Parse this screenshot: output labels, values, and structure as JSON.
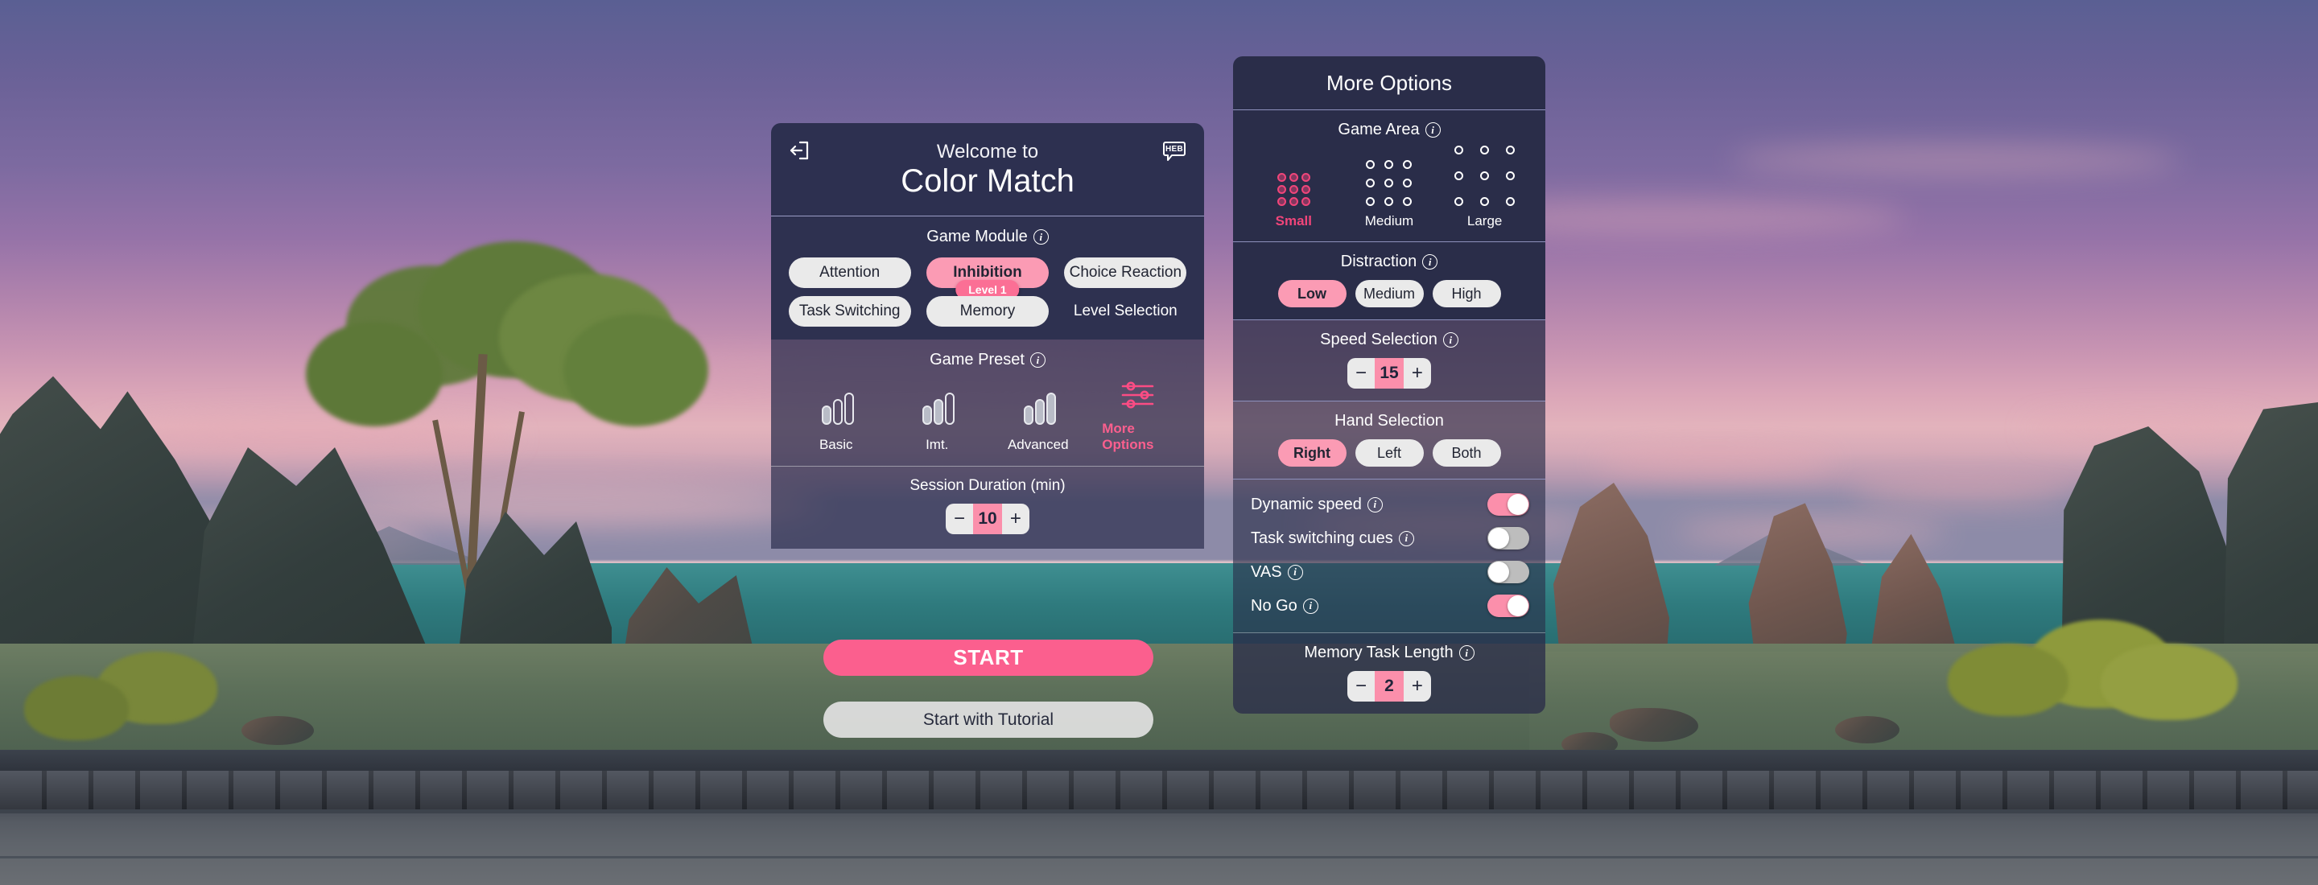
{
  "main_panel": {
    "exit_icon": "exit-icon",
    "language_badge": "HEB",
    "welcome_line": "Welcome to",
    "app_title": "Color Match",
    "game_module": {
      "label": "Game Module",
      "options": [
        {
          "label": "Attention",
          "selected": false,
          "plain": false
        },
        {
          "label": "Inhibition",
          "selected": true,
          "plain": false,
          "badge": "Level 1"
        },
        {
          "label": "Choice Reaction",
          "selected": false,
          "plain": false
        },
        {
          "label": "Task Switching",
          "selected": false,
          "plain": false
        },
        {
          "label": "Memory",
          "selected": false,
          "plain": false
        },
        {
          "label": "Level Selection",
          "selected": false,
          "plain": true
        }
      ]
    },
    "game_preset": {
      "label": "Game Preset",
      "options": [
        {
          "label": "Basic",
          "icon": "bars-1-icon",
          "active": false
        },
        {
          "label": "Imt.",
          "icon": "bars-2-icon",
          "active": false
        },
        {
          "label": "Advanced",
          "icon": "bars-3-icon",
          "active": false
        },
        {
          "label": "More Options",
          "icon": "sliders-icon",
          "active": true
        }
      ]
    },
    "session_duration": {
      "label": "Session Duration (min)",
      "value": "10",
      "minus": "−",
      "plus": "+"
    },
    "start_label": "START",
    "tutorial_label": "Start with Tutorial"
  },
  "more_options": {
    "title": "More Options",
    "game_area": {
      "label": "Game Area",
      "options": [
        {
          "label": "Small",
          "selected": true,
          "dot": 11,
          "gap": 4
        },
        {
          "label": "Medium",
          "selected": false,
          "dot": 11,
          "gap": 12
        },
        {
          "label": "Large",
          "selected": false,
          "dot": 11,
          "gap": 21
        }
      ]
    },
    "distraction": {
      "label": "Distraction",
      "options": [
        {
          "label": "Low",
          "selected": true
        },
        {
          "label": "Medium",
          "selected": false
        },
        {
          "label": "High",
          "selected": false
        }
      ]
    },
    "speed_selection": {
      "label": "Speed Selection",
      "value": "15",
      "minus": "−",
      "plus": "+"
    },
    "hand_selection": {
      "label": "Hand Selection",
      "options": [
        {
          "label": "Right",
          "selected": true
        },
        {
          "label": "Left",
          "selected": false
        },
        {
          "label": "Both",
          "selected": false
        }
      ]
    },
    "toggles": [
      {
        "label": "Dynamic speed",
        "on": true,
        "info": true
      },
      {
        "label": "Task switching cues",
        "on": false,
        "info": true
      },
      {
        "label": "VAS",
        "on": false,
        "info": true
      },
      {
        "label": "No Go",
        "on": true,
        "info": true
      }
    ],
    "memory_task_length": {
      "label": "Memory Task Length",
      "value": "2",
      "minus": "−",
      "plus": "+"
    }
  },
  "colors": {
    "accent_pink": "#fb5f8e",
    "selected_pink": "#fb9bb4",
    "panel_navy": "#2a2d49",
    "header_navy": "#2d3050",
    "pill_gray": "#eaeaea",
    "toggle_off": "#bdbdbd"
  }
}
